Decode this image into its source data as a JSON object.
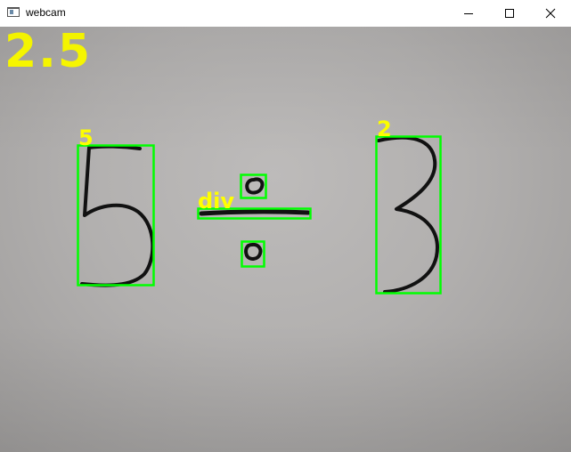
{
  "window": {
    "title": "webcam",
    "controls": {
      "minimize_icon": "minimize-icon",
      "maximize_icon": "maximize-icon",
      "close_icon": "close-icon"
    }
  },
  "result": {
    "text": "2.5"
  },
  "detections": [
    {
      "label": "5",
      "role": "digit"
    },
    {
      "label": "div",
      "role": "operator"
    },
    {
      "label": "2",
      "role": "digit"
    }
  ],
  "colors": {
    "box": "#00ff00",
    "label": "#ffff00",
    "ink": "#111111",
    "titlebar": "#ffffff"
  }
}
